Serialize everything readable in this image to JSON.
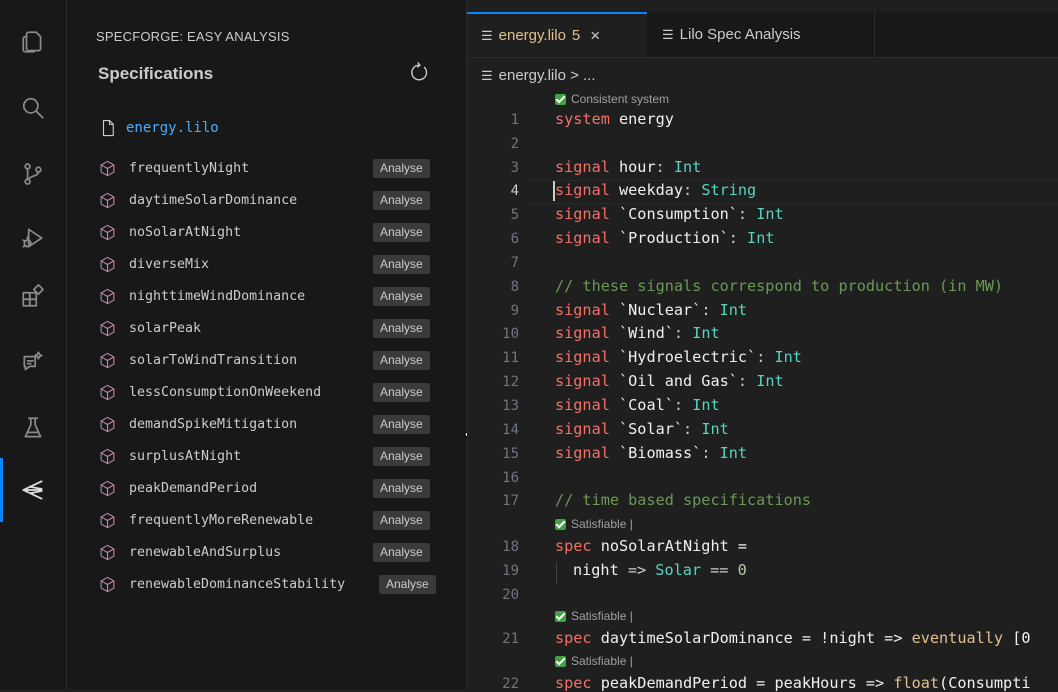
{
  "activity_bar": {
    "items": [
      "explorer-icon",
      "search-icon",
      "source-control-icon",
      "run-debug-icon",
      "extensions-icon",
      "chat-icon",
      "testing-icon",
      "specforge-icon"
    ],
    "active": "specforge-icon"
  },
  "sidebar": {
    "title": "SPECFORGE: EASY ANALYSIS",
    "heading": "Specifications",
    "file": "energy.lilo",
    "button_label": "Analyse",
    "specs": [
      "frequentlyNight",
      "daytimeSolarDominance",
      "noSolarAtNight",
      "diverseMix",
      "nighttimeWindDominance",
      "solarPeak",
      "solarToWindTransition",
      "lessConsumptionOnWeekend",
      "demandSpikeMitigation",
      "surplusAtNight",
      "peakDemandPeriod",
      "frequentlyMoreRenewable",
      "renewableAndSurplus",
      "renewableDominanceStability"
    ]
  },
  "tabs": [
    {
      "label": "energy.lilo",
      "count": "5",
      "close": "×"
    },
    {
      "label": "Lilo Spec Analysis"
    }
  ],
  "breadcrumb": "energy.lilo > ...",
  "code_lens": {
    "consistent": "Consistent system",
    "satisfiable": "Satisfiable |"
  },
  "line_numbers": [
    "1",
    "2",
    "3",
    "4",
    "5",
    "6",
    "7",
    "8",
    "9",
    "10",
    "11",
    "12",
    "13",
    "14",
    "15",
    "16",
    "17",
    "18",
    "19",
    "20",
    "21",
    "22"
  ],
  "code": {
    "l1": {
      "kw": "system",
      "id": " energy"
    },
    "l3": {
      "kw": "signal",
      "id": " hour",
      "p": ": ",
      "ty": "Int"
    },
    "l4": {
      "kw": "signal",
      "id": " weekday",
      "p": ": ",
      "ty": "String"
    },
    "l5": {
      "kw": "signal",
      "id": " `Consumption`",
      "p": ": ",
      "ty": "Int"
    },
    "l6": {
      "kw": "signal",
      "id": " `Production`",
      "p": ": ",
      "ty": "Int"
    },
    "l8": {
      "cm": "// these signals correspond to production (in MW)"
    },
    "l9": {
      "kw": "signal",
      "id": " `Nuclear`",
      "p": ": ",
      "ty": "Int"
    },
    "l10": {
      "kw": "signal",
      "id": " `Wind`",
      "p": ": ",
      "ty": "Int"
    },
    "l11": {
      "kw": "signal",
      "id": " `Hydroelectric`",
      "p": ": ",
      "ty": "Int"
    },
    "l12": {
      "kw": "signal",
      "id": " `Oil and Gas`",
      "p": ": ",
      "ty": "Int"
    },
    "l13": {
      "kw": "signal",
      "id": " `Coal`",
      "p": ": ",
      "ty": "Int"
    },
    "l14": {
      "kw": "signal",
      "id": " `Solar`",
      "p": ": ",
      "ty": "Int"
    },
    "l15": {
      "kw": "signal",
      "id": " `Biomass`",
      "p": ": ",
      "ty": "Int"
    },
    "l17": {
      "cm": "// time based specifications"
    },
    "l18": {
      "kw": "spec",
      "id": " noSolarAtNight =",
      "p": "",
      "ty": ""
    },
    "l19": {
      "id": "night",
      "op": " => ",
      "ty": "Solar",
      "op2": " == ",
      "num": "0"
    },
    "l21": {
      "kw": "spec",
      "id": " daytimeSolarDominance = !night => ",
      "fn": "eventually",
      "rest": " [0"
    },
    "l22": {
      "kw": "spec",
      "id": " peakDemandPeriod = peakHours => ",
      "fn": "float",
      "rest": "(Consumpti"
    }
  }
}
